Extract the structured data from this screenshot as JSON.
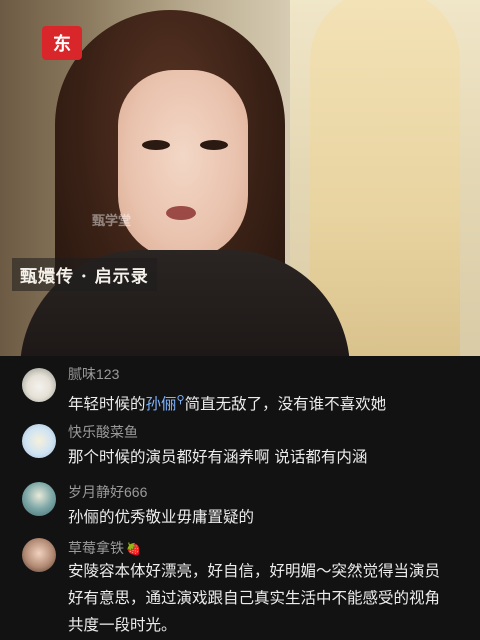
{
  "video": {
    "logo_text": "东",
    "watermark_text": "甄学堂",
    "caption_text": "甄嬛传 · 启示录"
  },
  "comments": [
    {
      "username": "腻味123",
      "text_before": "年轻时候的",
      "link_text": "孙俪",
      "link_icon": "search-icon",
      "text_after": "简直无敌了，没有谁不喜欢她"
    },
    {
      "username": "快乐酸菜鱼",
      "text": "那个时候的演员都好有涵养啊 说话都有内涵"
    },
    {
      "username": "岁月静好666",
      "text": "孙俪的优秀敬业毋庸置疑的"
    },
    {
      "username": "草莓拿铁",
      "username_badge_icon": "strawberry-icon",
      "text_line1": "安陵容本体好漂亮，好自信，好明媚～突然觉得当演员",
      "text_line2": "好有意思，通过演戏跟自己真实生活中不能感受的视角",
      "text_line3": "共度一段时光。"
    }
  ]
}
